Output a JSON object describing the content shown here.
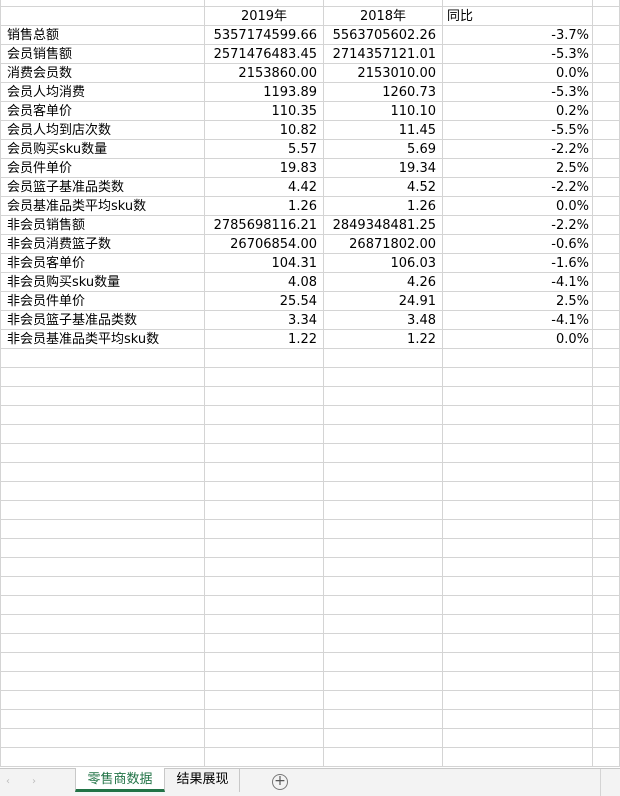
{
  "header": {
    "col_a": "",
    "col_b": "2019年",
    "col_c": "2018年",
    "col_d": "同比"
  },
  "rows": [
    {
      "label": "销售总额",
      "v2019": "5357174599.66",
      "v2018": "5563705602.26",
      "yoy": "-3.7%"
    },
    {
      "label": "会员销售额",
      "v2019": "2571476483.45",
      "v2018": "2714357121.01",
      "yoy": "-5.3%"
    },
    {
      "label": "消费会员数",
      "v2019": "2153860.00",
      "v2018": "2153010.00",
      "yoy": "0.0%"
    },
    {
      "label": "会员人均消费",
      "v2019": "1193.89",
      "v2018": "1260.73",
      "yoy": "-5.3%"
    },
    {
      "label": "会员客单价",
      "v2019": "110.35",
      "v2018": "110.10",
      "yoy": "0.2%"
    },
    {
      "label": "会员人均到店次数",
      "v2019": "10.82",
      "v2018": "11.45",
      "yoy": "-5.5%"
    },
    {
      "label": "会员购买sku数量",
      "v2019": "5.57",
      "v2018": "5.69",
      "yoy": "-2.2%"
    },
    {
      "label": "会员件单价",
      "v2019": "19.83",
      "v2018": "19.34",
      "yoy": "2.5%"
    },
    {
      "label": "会员篮子基准品类数",
      "v2019": "4.42",
      "v2018": "4.52",
      "yoy": "-2.2%"
    },
    {
      "label": "会员基准品类平均sku数",
      "v2019": "1.26",
      "v2018": "1.26",
      "yoy": "0.0%"
    },
    {
      "label": "非会员销售额",
      "v2019": "2785698116.21",
      "v2018": "2849348481.25",
      "yoy": "-2.2%"
    },
    {
      "label": "非会员消费篮子数",
      "v2019": "26706854.00",
      "v2018": "26871802.00",
      "yoy": "-0.6%"
    },
    {
      "label": "非会员客单价",
      "v2019": "104.31",
      "v2018": "106.03",
      "yoy": "-1.6%"
    },
    {
      "label": "非会员购买sku数量",
      "v2019": "4.08",
      "v2018": "4.26",
      "yoy": "-4.1%"
    },
    {
      "label": "非会员件单价",
      "v2019": "25.54",
      "v2018": "24.91",
      "yoy": "2.5%"
    },
    {
      "label": "非会员篮子基准品类数",
      "v2019": "3.34",
      "v2018": "3.48",
      "yoy": "-4.1%"
    },
    {
      "label": "非会员基准品类平均sku数",
      "v2019": "1.22",
      "v2018": "1.22",
      "yoy": "0.0%"
    }
  ],
  "empty_row_count": 22,
  "tabs": {
    "prev_icon": "‹",
    "next_icon": "›",
    "active": "零售商数据",
    "second": "结果展现",
    "add_icon": "+"
  },
  "colors": {
    "accent": "#217346",
    "gridline": "#d4d4d4"
  }
}
